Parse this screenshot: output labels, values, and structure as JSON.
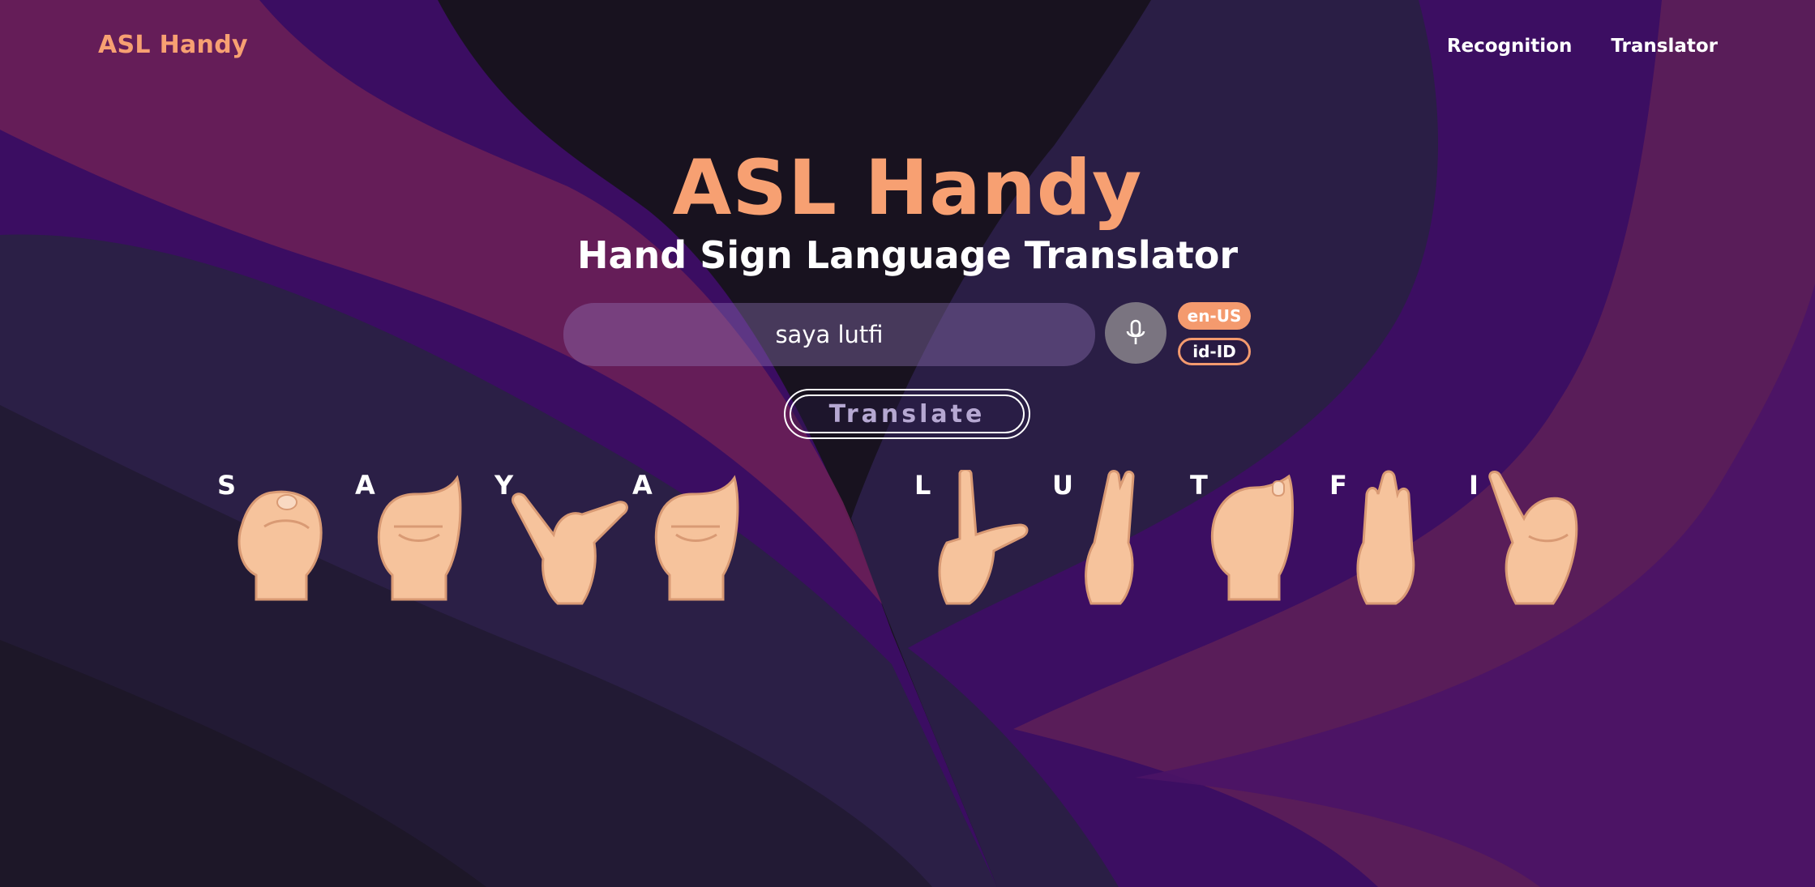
{
  "nav": {
    "brand": "ASL Handy",
    "links": [
      {
        "label": "Recognition"
      },
      {
        "label": "Translator"
      }
    ]
  },
  "hero": {
    "title": "ASL Handy",
    "subtitle": "Hand Sign Language Translator"
  },
  "search": {
    "value": "saya lutfi",
    "mic_icon": "microphone-icon"
  },
  "languages": [
    {
      "label": "en-US",
      "selected": true
    },
    {
      "label": "id-ID",
      "selected": false
    }
  ],
  "translate_button": {
    "label": "Translate"
  },
  "signs": [
    {
      "letter": "S",
      "icon": "asl-s-hand-icon"
    },
    {
      "letter": "A",
      "icon": "asl-a-hand-icon"
    },
    {
      "letter": "Y",
      "icon": "asl-y-hand-icon"
    },
    {
      "letter": "A",
      "icon": "asl-a-hand-icon"
    },
    {
      "letter": "L",
      "icon": "asl-l-hand-icon"
    },
    {
      "letter": "U",
      "icon": "asl-u-hand-icon"
    },
    {
      "letter": "T",
      "icon": "asl-t-hand-icon"
    },
    {
      "letter": "F",
      "icon": "asl-f-hand-icon"
    },
    {
      "letter": "I",
      "icon": "asl-i-hand-icon"
    }
  ],
  "colors": {
    "accent": "#f7a072",
    "background_dark": "#1a1426",
    "purple": "#3a0f66",
    "magenta": "#6b2060",
    "skin": "#f6c39c"
  }
}
